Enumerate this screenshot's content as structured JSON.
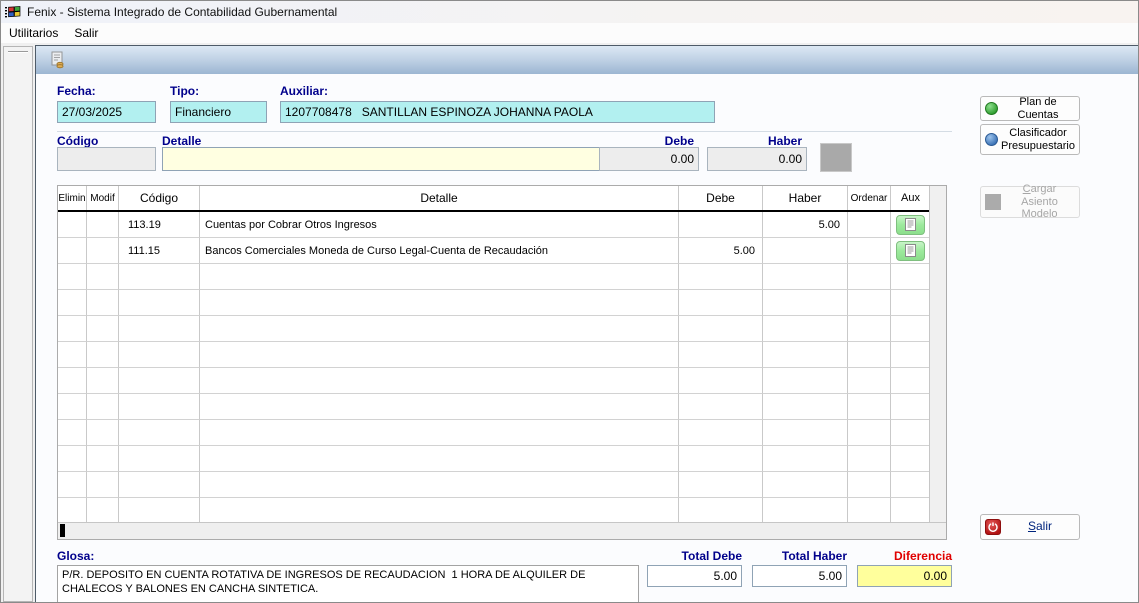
{
  "window": {
    "title": "Fenix - Sistema Integrado de Contabilidad Gubernamental",
    "menu": [
      {
        "label": "Utilitarios"
      },
      {
        "label": "Salir"
      }
    ]
  },
  "form": {
    "fecha_label": "Fecha:",
    "fecha_value": "27/03/2025",
    "tipo_label": "Tipo:",
    "tipo_value": "Financiero",
    "auxiliar_label": "Auxiliar:",
    "auxiliar_value": "1207708478   SANTILLAN ESPINOZA JOHANNA PAOLA",
    "codigo_label": "Código",
    "detalle_label": "Detalle",
    "codigo_value": "",
    "detalle_value": "",
    "debe_label": "Debe",
    "debe_value": "0.00",
    "haber_label": "Haber",
    "haber_value": "0.00"
  },
  "grid": {
    "headers": {
      "elimin": "Elimin",
      "modif": "Modif",
      "codigo": "Código",
      "detalle": "Detalle",
      "debe": "Debe",
      "haber": "Haber",
      "ordenar": "Ordenar",
      "aux": "Aux"
    },
    "rows": [
      {
        "codigo": "113.19",
        "detalle": "Cuentas por Cobrar Otros Ingresos",
        "debe": "",
        "haber": "5.00"
      },
      {
        "codigo": "111.15",
        "detalle": "Bancos Comerciales Moneda de Curso Legal-Cuenta de Recaudación",
        "debe": "5.00",
        "haber": ""
      }
    ],
    "empty_rows": 10
  },
  "side_buttons": {
    "plan_cuentas": "Plan de Cuentas",
    "clasificador": "Clasificador Presupuestario",
    "cargar_asiento": "Cargar Asiento Modelo",
    "salir": "Salir"
  },
  "footer": {
    "glosa_label": "Glosa:",
    "glosa_value": "P/R. DEPOSITO EN CUENTA ROTATIVA DE INGRESOS DE RECAUDACION  1 HORA DE ALQUILER DE CHALECOS Y BALONES EN CANCHA SINTETICA.",
    "total_debe_label": "Total Debe",
    "total_debe_value": "5.00",
    "total_haber_label": "Total Haber",
    "total_haber_value": "5.00",
    "diferencia_label": "Diferencia",
    "diferencia_value": "0.00"
  },
  "colors": {
    "label_navy": "#00008B",
    "diferencia_red": "#E00000",
    "field_cyan": "#B2F0F0",
    "field_yellow": "#FFFFE1",
    "diferencia_yellow": "#FFFF9C",
    "aux_green": "#9CEA9C",
    "toolbar_blue": "#9CB6D2"
  }
}
